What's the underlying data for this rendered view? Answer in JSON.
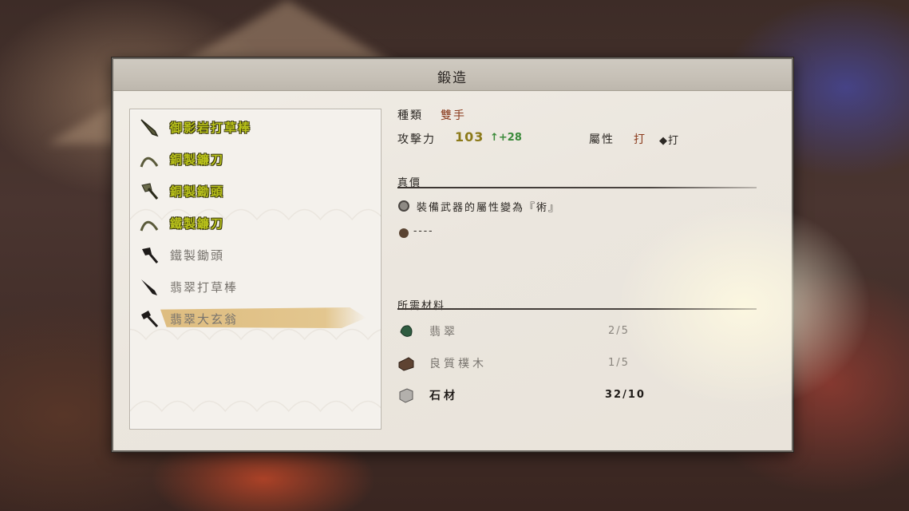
{
  "window": {
    "title": "鍛造"
  },
  "weapon_list": [
    {
      "label": "御影岩打草棒",
      "icon": "club-icon",
      "is_new": true,
      "selected": false
    },
    {
      "label": "銅製鐮刀",
      "icon": "sickle-icon",
      "is_new": true,
      "selected": false
    },
    {
      "label": "銅製鋤頭",
      "icon": "hoe-icon",
      "is_new": true,
      "selected": false
    },
    {
      "label": "鐵製鐮刀",
      "icon": "sickle-icon",
      "is_new": true,
      "selected": false
    },
    {
      "label": "鐵製鋤頭",
      "icon": "hoe-icon",
      "is_new": false,
      "selected": false
    },
    {
      "label": "翡翠打草棒",
      "icon": "club-icon",
      "is_new": false,
      "selected": false
    },
    {
      "label": "翡翠大玄翁",
      "icon": "hammer-icon",
      "is_new": false,
      "selected": true
    }
  ],
  "details": {
    "type_label": "種類",
    "type_value": "雙手",
    "attack_label": "攻擊力",
    "attack_value": "103",
    "attack_diff": "↑+28",
    "attribute_label": "屬性",
    "attribute_value": "打",
    "attribute_change": "◆打",
    "true_value_header": "真價",
    "effects": [
      {
        "text": "裝備武器的屬性變為『術』",
        "dot": "grey"
      },
      {
        "text": "----",
        "dot": "brown"
      }
    ],
    "materials_header": "所需材料",
    "materials": [
      {
        "name": "翡翠",
        "count": "2/5",
        "icon": "jade-icon",
        "enough": false
      },
      {
        "name": "良質樸木",
        "count": "1/5",
        "icon": "wood-icon",
        "enough": false
      },
      {
        "name": "石材",
        "count": "32/10",
        "icon": "stone-icon",
        "enough": true
      }
    ]
  },
  "colors": {
    "new_item": "#b9c21a",
    "selected_highlight": "#ddba7a",
    "type_accent": "#8a3a1c",
    "attack_up": "#3b8a3a"
  }
}
